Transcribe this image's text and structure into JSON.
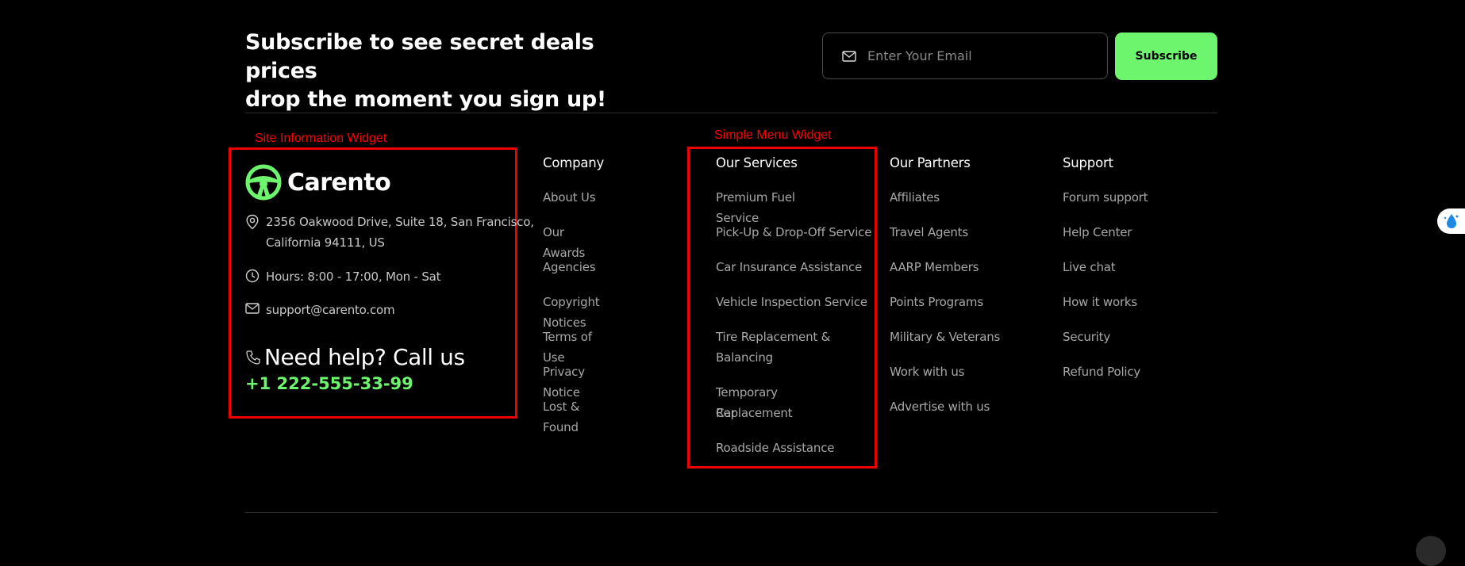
{
  "subscribe": {
    "title_line1": "Subscribe to see secret deals prices",
    "title_line2": "drop the moment you sign up!",
    "email_placeholder": "Enter Your Email",
    "button_label": "Subscribe"
  },
  "annotations": {
    "site_info_label": "Site Information Widget",
    "simple_menu_label": "Simple Menu Widget",
    "color": "#ff0000"
  },
  "site_info": {
    "brand": "Carento",
    "address_line1": "2356 Oakwood Drive, Suite 18, San Francisco,",
    "address_line2": "California 94111, US",
    "hours": "Hours: 8:00 - 17:00, Mon - Sat",
    "email": "support@carento.com",
    "help_text": "Need help? Call us",
    "phone": "+1 222-555-33-99"
  },
  "menus": {
    "company": {
      "title": "Company",
      "items": [
        "About Us",
        "Our Awards",
        "Agencies",
        "Copyright Notices",
        "Terms of Use",
        "Privacy Notice",
        "Lost & Found"
      ]
    },
    "services": {
      "title": "Our Services",
      "items": [
        "Premium Fuel Service",
        "Pick-Up & Drop-Off Service",
        "Car Insurance Assistance",
        "Vehicle Inspection Service",
        "Tire Replacement &",
        "Balancing",
        "Temporary Car",
        "Replacement",
        "Roadside Assistance"
      ]
    },
    "partners": {
      "title": "Our Partners",
      "items": [
        "Affiliates",
        "Travel Agents",
        "AARP Members",
        "Points Programs",
        "Military & Veterans",
        "Work with us",
        "Advertise with us"
      ]
    },
    "support": {
      "title": "Support",
      "items": [
        "Forum support",
        "Help Center",
        "Live chat",
        "How it works",
        "Security",
        "Refund Policy"
      ]
    }
  },
  "colors": {
    "accent": "#6ef56e",
    "background": "#000000",
    "annotation": "#ee0000"
  }
}
